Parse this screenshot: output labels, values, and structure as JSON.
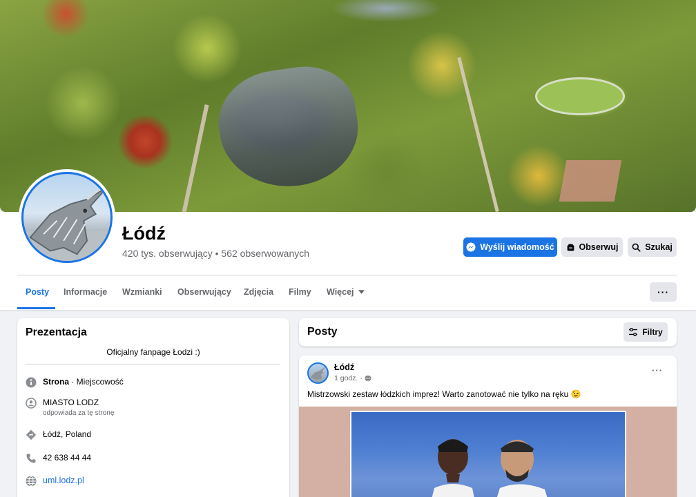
{
  "page": {
    "name": "Łódź",
    "stats": "420 tys. obserwujący • 562 obserwowanych"
  },
  "actions": {
    "message": "Wyślij wiadomość",
    "follow": "Obserwuj",
    "search": "Szukaj",
    "more": "···"
  },
  "tabs": [
    {
      "label": "Posty",
      "active": true
    },
    {
      "label": "Informacje"
    },
    {
      "label": "Wzmianki"
    },
    {
      "label": "Obserwujący"
    },
    {
      "label": "Zdjęcia"
    },
    {
      "label": "Filmy"
    },
    {
      "label": "Więcej"
    }
  ],
  "intro": {
    "title": "Prezentacja",
    "description": "Oficjalny fanpage Łodzi :)",
    "category_bold": "Strona",
    "category_rest": " · Miejscowość",
    "responsible_name": "MIASTO LODZ",
    "responsible_sub": "odpowiada za tę stronę",
    "location": "Łódź, Poland",
    "phone": "42 638 44 44",
    "website": "uml.lodz.pl"
  },
  "posts_section": {
    "title": "Posty",
    "filter_label": "Filtry"
  },
  "post": {
    "author": "Łódź",
    "time": "1 godz. ·",
    "text": "Mistrzowski zestaw łódzkich imprez! Warto zanotować nie tylko na ręku 😉",
    "menu": "···"
  },
  "colors": {
    "accent": "#1b74e4",
    "background": "#f0f2f5",
    "secondary_text": "#65676b",
    "button_grey": "#e4e6eb"
  }
}
